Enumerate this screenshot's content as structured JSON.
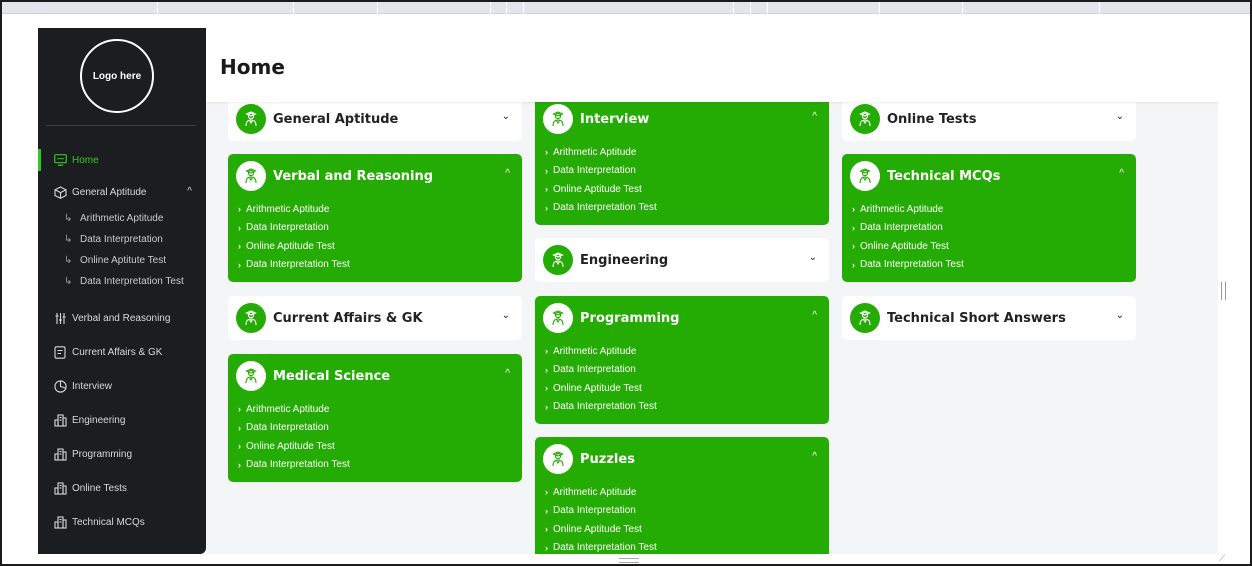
{
  "sidebar": {
    "logo_text": "Logo here",
    "nav": [
      {
        "label": "Home",
        "icon": "monitor-icon",
        "active": true
      },
      {
        "label": "General Aptitude",
        "icon": "cube-icon",
        "expanded": true
      },
      {
        "label": "Verbal and Reasoning",
        "icon": "sliders-icon"
      },
      {
        "label": "Current Affairs & GK",
        "icon": "document-icon"
      },
      {
        "label": "Interview",
        "icon": "pie-chart-icon"
      },
      {
        "label": "Engineering",
        "icon": "building-icon"
      },
      {
        "label": "Programming",
        "icon": "building-icon"
      },
      {
        "label": "Online Tests",
        "icon": "building-icon"
      },
      {
        "label": "Technical MCQs",
        "icon": "building-icon"
      }
    ],
    "sub_items": [
      "Arithmetic Aptitude",
      "Data Interpretation",
      "Online Aptitute Test",
      "Data Interpretation Test"
    ],
    "accent": "#2ecb1a"
  },
  "header": {
    "title": "Home"
  },
  "cards": {
    "col1": [
      {
        "title": "General Aptitude",
        "expanded": false
      },
      {
        "title": "Verbal and Reasoning",
        "expanded": true,
        "items": [
          "Arithmetic Aptitude",
          "Data Interpretation",
          "Online Aptitude Test",
          "Data Interpretation Test"
        ]
      },
      {
        "title": "Current Affairs & GK",
        "expanded": false
      },
      {
        "title": "Medical Science",
        "expanded": true,
        "items": [
          "Arithmetic Aptitude",
          "Data Interpretation",
          "Online Aptitude Test",
          "Data Interpretation Test"
        ]
      }
    ],
    "col2": [
      {
        "title": "Interview",
        "expanded": true,
        "items": [
          "Arithmetic Aptitude",
          "Data Interpretation",
          "Online Aptitude Test",
          "Data Interpretation Test"
        ]
      },
      {
        "title": "Engineering",
        "expanded": false
      },
      {
        "title": "Programming",
        "expanded": true,
        "items": [
          "Arithmetic Aptitude",
          "Data Interpretation",
          "Online Aptitude Test",
          "Data Interpretation Test"
        ]
      },
      {
        "title": "Puzzles",
        "expanded": true,
        "items": [
          "Arithmetic Aptitude",
          "Data Interpretation",
          "Online Aptitude Test",
          "Data Interpretation Test"
        ]
      }
    ],
    "col3": [
      {
        "title": "Online Tests",
        "expanded": false
      },
      {
        "title": "Technical MCQs",
        "expanded": true,
        "items": [
          "Arithmetic Aptitude",
          "Data Interpretation",
          "Online Aptitude Test",
          "Data Interpretation Test"
        ]
      },
      {
        "title": "Technical Short Answers",
        "expanded": false
      }
    ],
    "green": "#25ac04"
  }
}
